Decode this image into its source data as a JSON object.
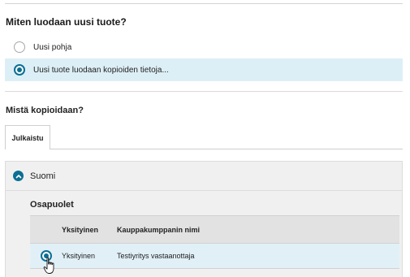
{
  "question": "Miten luodaan uusi tuote?",
  "options": [
    {
      "label": "Uusi pohja",
      "selected": false
    },
    {
      "label": "Uusi tuote luodaan kopioiden tietoja...",
      "selected": true
    }
  ],
  "copy_question": "Mistä kopioidaan?",
  "tabs": [
    {
      "label": "Julkaistu",
      "active": true
    }
  ],
  "panel": {
    "title": "Suomi",
    "expanded": true,
    "section_title": "Osapuolet",
    "table": {
      "headers": [
        "",
        "Yksityinen",
        "Kauppakumppanin nimi"
      ],
      "rows": [
        {
          "selected": true,
          "type": "Yksityinen",
          "name": "Testiyritys vastaanottaja"
        }
      ]
    }
  },
  "colors": {
    "accent": "#0b6f93",
    "selected_row": "#ddeff6"
  },
  "icons": {
    "expand": "chevron-up-icon",
    "cursor": "hand-pointer-icon"
  }
}
